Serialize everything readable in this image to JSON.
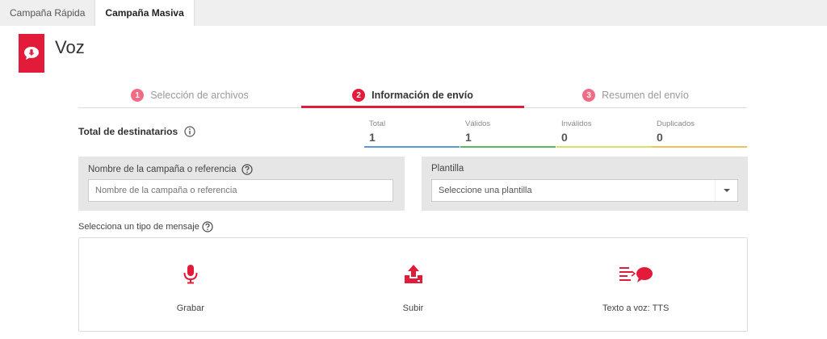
{
  "tabs": [
    {
      "label": "Campaña Rápida",
      "active": false
    },
    {
      "label": "Campaña Masiva",
      "active": true
    }
  ],
  "app": {
    "title": "Voz",
    "icon": "voice-bubble-icon"
  },
  "steps": [
    {
      "num": "1",
      "label": "Selección de archivos",
      "active": false
    },
    {
      "num": "2",
      "label": "Información de envío",
      "active": true
    },
    {
      "num": "3",
      "label": "Resumen del envío",
      "active": false
    }
  ],
  "recipients": {
    "label": "Total de destinatarios",
    "stats": [
      {
        "label": "Total",
        "value": "1",
        "color": "#5b9bd5"
      },
      {
        "label": "Válidos",
        "value": "1",
        "color": "#5cb85c"
      },
      {
        "label": "Inválidos",
        "value": "0",
        "color": "#d9e06a"
      },
      {
        "label": "Duplicados",
        "value": "0",
        "color": "#f0c05a"
      }
    ]
  },
  "campaign_name": {
    "label": "Nombre de la campaña o referencia",
    "placeholder": "Nombre de la campaña o referencia"
  },
  "template": {
    "label": "Plantilla",
    "selected": "Seleccione una plantilla"
  },
  "message_type": {
    "label": "Selecciona un tipo de mensaje",
    "options": [
      {
        "label": "Grabar",
        "icon": "microphone-icon"
      },
      {
        "label": "Subir",
        "icon": "upload-icon"
      },
      {
        "label": "Texto a voz: TTS",
        "icon": "text-to-speech-icon"
      }
    ]
  },
  "colors": {
    "accent": "#e31b3a",
    "step_inactive": "#f06c84"
  }
}
